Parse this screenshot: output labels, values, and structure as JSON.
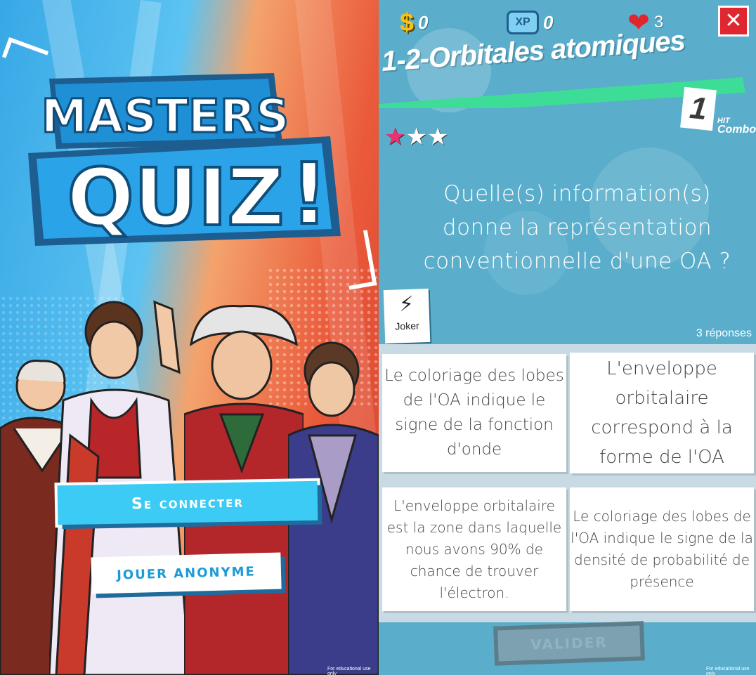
{
  "left_screen": {
    "logo": {
      "line1": "MASTERS",
      "line2": "QUIZ",
      "exclamation": "!"
    },
    "connect_label": "Se connecter",
    "anonymous_label": "jouer anonyme",
    "footer_note": "For educational use only"
  },
  "right_screen": {
    "stats": {
      "coins": "0",
      "xp_badge": "XP",
      "xp": "0",
      "lives": "3"
    },
    "close_label": "✕",
    "level_title": "1-2-Orbitales atomiques",
    "combo": {
      "count": "1",
      "hit": "HIT",
      "label": "Combo"
    },
    "stars": {
      "earned": 1,
      "total": 3
    },
    "question": "Quelle(s) information(s) donne la représentation conventionnelle d'une OA ?",
    "joker_label": "Joker",
    "answer_count": "3 réponses",
    "answers": [
      "Le coloriage des lobes de l'OA indique le signe de la fonction d'onde",
      "L'enveloppe orbitalaire correspond à la forme de l'OA",
      "L'enveloppe orbitalaire est la zone dans laquelle nous avons 90% de chance de trouver l'électron.",
      "Le coloriage des lobes de l'OA indique le signe de la densité de probabilité de présence"
    ],
    "validate_label": "VALIDER",
    "footer_note": "For educational use only"
  },
  "colors": {
    "accent_blue": "#3ccbf4",
    "close_red": "#e0262e",
    "title_band_green": "#3ddc97",
    "star_pink": "#e8336f",
    "panel_bg": "#5aaecb"
  }
}
